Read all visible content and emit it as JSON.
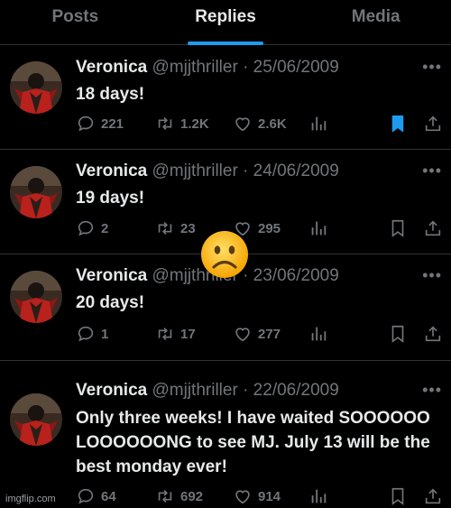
{
  "tabs": [
    {
      "label": "Posts"
    },
    {
      "label": "Replies"
    },
    {
      "label": "Media"
    }
  ],
  "active_tab": "Replies",
  "accent_color": "#1d9bf0",
  "tweets": [
    {
      "name": "Veronica",
      "handle": "@mjjthriller",
      "date": "· 25/06/2009",
      "text": "18 days!",
      "replies": "221",
      "retweets": "1.2K",
      "likes": "2.6K",
      "bookmarked": true
    },
    {
      "name": "Veronica",
      "handle": "@mjjthriller",
      "date": "· 24/06/2009",
      "text": "19 days!",
      "replies": "2",
      "retweets": "23",
      "likes": "295",
      "bookmarked": false
    },
    {
      "name": "Veronica",
      "handle": "@mjjthriller",
      "date": "· 23/06/2009",
      "text": "20 days!",
      "replies": "1",
      "retweets": "17",
      "likes": "277",
      "bookmarked": false
    },
    {
      "name": "Veronica",
      "handle": "@mjjthriller",
      "date": "· 22/06/2009",
      "text": "Only three weeks! I have waited SOOOOOO LOOOOOONG to see MJ. July 13 will be the best monday ever!",
      "replies": "64",
      "retweets": "692",
      "likes": "914",
      "bookmarked": false
    }
  ],
  "overlay": {
    "emoji": "frowning-face"
  },
  "watermark": "imgflip.com"
}
